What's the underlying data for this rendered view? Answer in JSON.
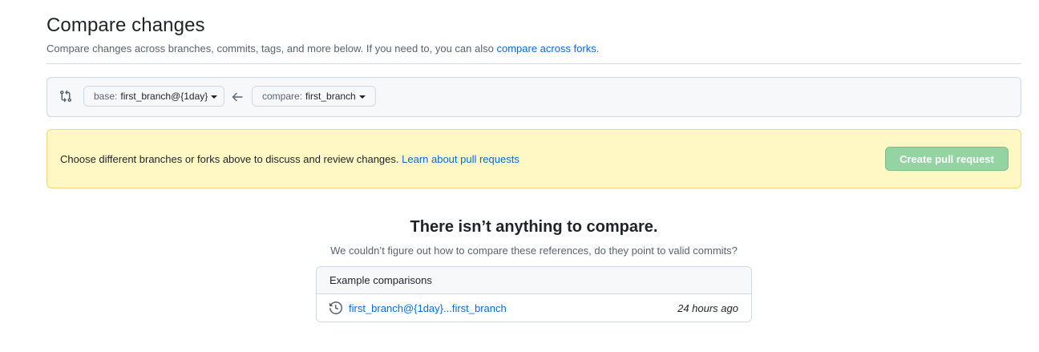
{
  "header": {
    "title": "Compare changes",
    "subtitle_prefix": "Compare changes across branches, commits, tags, and more below. If you need to, you can also ",
    "subtitle_link": "compare across forks",
    "subtitle_suffix": "."
  },
  "range": {
    "base_prefix": "base:",
    "base_branch": "first_branch@{1day}",
    "compare_prefix": "compare:",
    "compare_branch": "first_branch"
  },
  "flash": {
    "message": "Choose different branches or forks above to discuss and review changes. ",
    "link": "Learn about pull requests",
    "button_label": "Create pull request"
  },
  "blankslate": {
    "title": "There isn’t anything to compare.",
    "description": "We couldn’t figure out how to compare these references, do they point to valid commits?"
  },
  "examples": {
    "heading": "Example comparisons",
    "rows": [
      {
        "label": "first_branch@{1day}...first_branch",
        "time": "24 hours ago"
      }
    ]
  },
  "colors": {
    "link": "#0969da",
    "flash_bg": "#fff8c5",
    "create_button_disabled": "#94d3a2"
  }
}
